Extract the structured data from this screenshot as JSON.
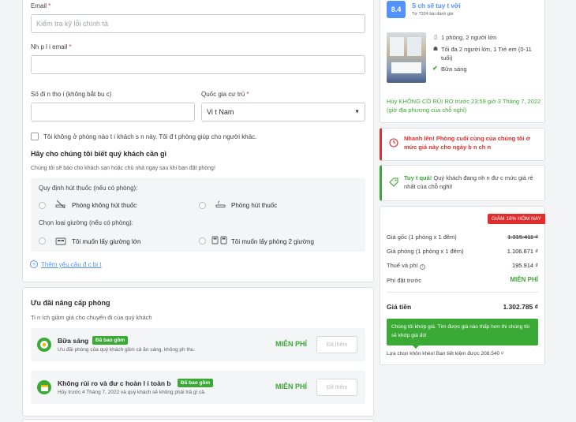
{
  "form": {
    "email_label": "Email",
    "email_placeholder": "Kiểm tra kỹ lỗi chính tả",
    "confirm_email_label": "Nh p l i email",
    "phone_label": "Số đi n tho i (không bắt bu c)",
    "country_label": "Quốc gia cư trú",
    "country_value": "Vi t Nam",
    "not_staying_label": "Tôi không ở phòng nào t i khách s n này. Tôi đ t phòng giúp cho người khác.",
    "needs_title": "Hãy cho chúng tôi biết quý khách cần gì",
    "needs_sub": "Chúng tôi sẽ báo cho khách sạn hoặc chủ nhà ngay sau khi bạn đặt phòng!",
    "smoking_label": "Quy định hút thuốc (nếu có phòng):",
    "non_smoking": "Phòng không hút thuốc",
    "smoking": "Phòng hút thuốc",
    "bed_label": "Chọn loại giường (nếu có phòng):",
    "large_bed": "Tôi muốn lấy giường lớn",
    "two_beds": "Tôi muốn lấy phòng 2 giường",
    "add_request": "Thêm yêu cầu đ c bi t"
  },
  "upgrades": {
    "title": "Ưu đãi nâng cấp phòng",
    "sub": "Ti n ích giảm giá cho chuyến đi của quý khách",
    "items": [
      {
        "name": "Bữa sáng",
        "badge": "Đã bao gồm",
        "desc": "Ưu đãi phòng của quý khách gồm cả ăn sáng, không ph  thu.",
        "price": "MIỄN PHÍ",
        "button": "Đã thêm"
      },
      {
        "name": "Không rủi ro và đư c hoàn l i toàn b",
        "badge": "Đã bao gồm",
        "desc": "Hủy trước 4 Tháng 7, 2022 và quý khách sẽ không phải trả gì cả.",
        "price": "MIỄN PHÍ",
        "button": "Đã thêm"
      }
    ]
  },
  "hotel": {
    "score": "8.4",
    "rating_text": "S ch sẽ tuy t vời",
    "reviews": "Từ 7324 bài đánh giá",
    "room": "1 phòng, 2 người lớn",
    "max": "Tối đa 2 người lớn, 1 Trẻ em (0-11 tuổi)",
    "breakfast": "Bữa sáng",
    "cancel": "Hủy KHÔNG CÓ RỦI RO trước 23:59 giờ 3 Tháng 7, 2022 (giờ địa phương của chỗ nghỉ)"
  },
  "alerts": {
    "hurry": "Nhanh lên! Phòng cuối cùng của chúng tôi ở mức giá này cho ngày b n ch n",
    "great_prefix": "Tuy t quá!",
    "great": " Quý khách đang nh n đư c mức giá rẻ nhất của chỗ nghỉ!"
  },
  "price": {
    "discount_badge": "GIẢM 16% HÔM NAY",
    "original_label": "Giá gốc (1 phòng x 1 đêm)",
    "original_value": "1.315.411 ₫",
    "room_label": "Giá phòng (1 phòng x 1 đêm)",
    "room_value": "1.106.871 ₫",
    "tax_label": "Thuế và phí",
    "tax_value": "195.914 ₫",
    "booking_fee_label": "Phí đặt trước",
    "booking_fee_value": "MIỄN PHÍ",
    "total_label": "Giá tiền",
    "total_value": "1.302.785 ₫",
    "match_text": "Chúng tôi khớp giá. Tìm được giá nào thấp hơn thì chúng tôi sẽ khớp giá đó!",
    "savings": "Lựa chọn khôn khéo! Bạn tiết kiệm được 208.540 ₫"
  },
  "colors": {
    "accent": "#5392f9",
    "green": "#3aa935",
    "red": "#e12d2d"
  }
}
